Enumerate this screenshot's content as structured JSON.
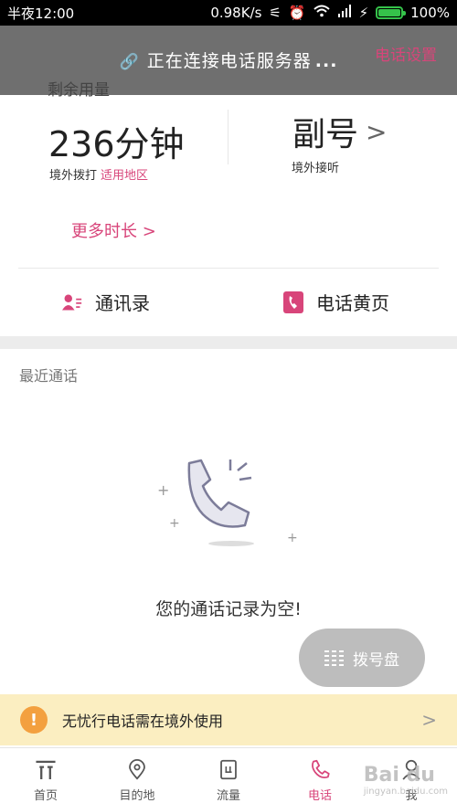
{
  "status_bar": {
    "time": "半夜12:00",
    "speed": "0.98K/s",
    "battery": "100%",
    "battery_level": 1.0
  },
  "header": {
    "connecting": "正在连接电话服务器",
    "dots": "...",
    "settings": "电话设置",
    "remaining": "剩余用量"
  },
  "balance": {
    "minutes": "236分钟",
    "outbound": "境外拨打",
    "regions": "适用地区",
    "secondary": "副号",
    "inbound": "境外接听",
    "more": "更多时长"
  },
  "actions": {
    "contacts": "通讯录",
    "yellow_pages": "电话黄页"
  },
  "recent": {
    "title": "最近通话",
    "empty": "您的通话记录为空!"
  },
  "dialpad": {
    "label": "拨号盘"
  },
  "notice": {
    "text": "无忧行电话需在境外使用"
  },
  "nav": [
    {
      "label": "首页"
    },
    {
      "label": "目的地"
    },
    {
      "label": "流量"
    },
    {
      "label": "电话"
    },
    {
      "label": "我"
    }
  ],
  "watermark": {
    "brand": "Bai du",
    "sub": "jingyan.baidu.com"
  },
  "colors": {
    "accent": "#d8457a",
    "header_overlay": "#6f6f6f",
    "notice_bg": "#fbeec1",
    "warn": "#f3a03f"
  }
}
